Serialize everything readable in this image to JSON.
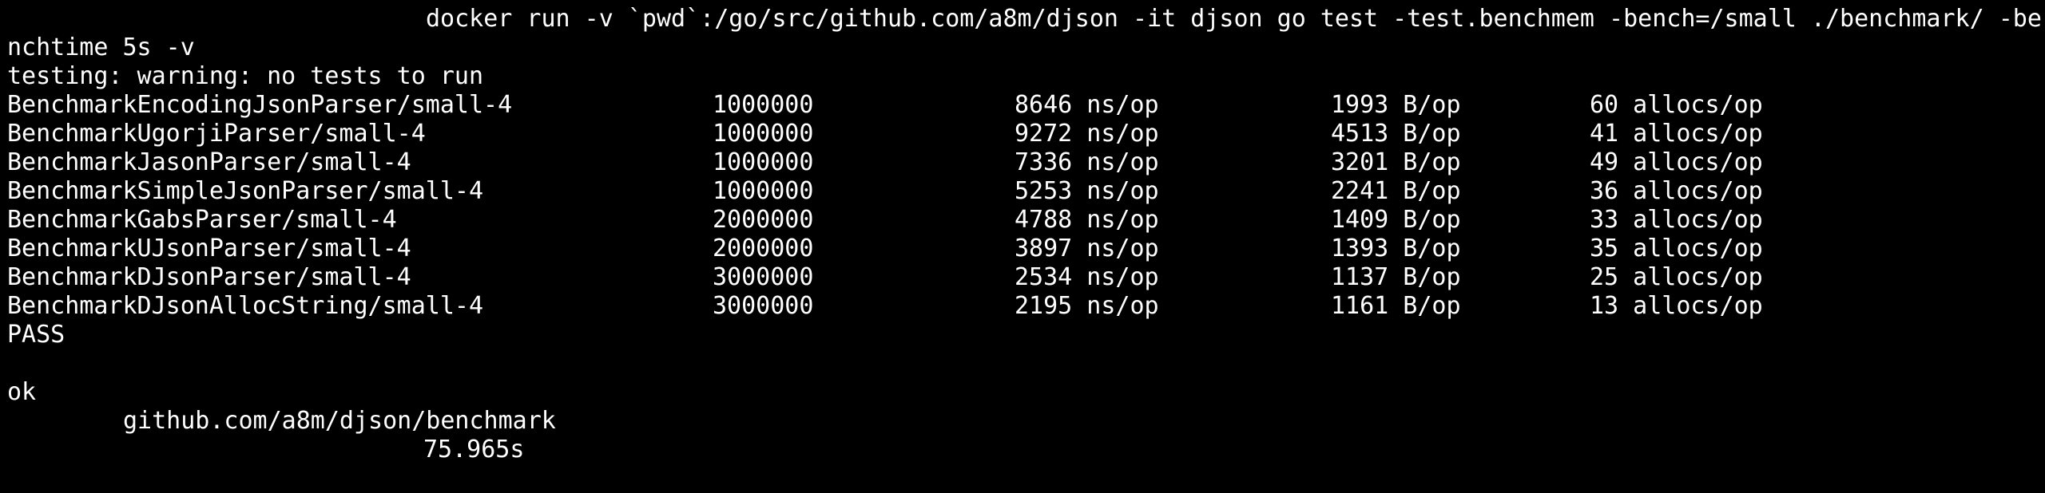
{
  "terminal": {
    "background": "#000000",
    "foreground": "#ffffff",
    "command_line": "docker run -v `pwd`:/go/src/github.com/a8m/djson -it djson go test -test.benchmem -bench=/small ./benchmark/ -be",
    "command_wrap": "nchtime 5s -v",
    "warning": "testing: warning: no tests to run",
    "benchmarks": [
      {
        "name": "BenchmarkEncodingJsonParser/small-4",
        "iterations": "1000000",
        "ns_per_op": "8646 ns/op",
        "bytes_per_op": "1993 B/op",
        "allocs_per_op": "60 allocs/op"
      },
      {
        "name": "BenchmarkUgorjiParser/small-4",
        "iterations": "1000000",
        "ns_per_op": "9272 ns/op",
        "bytes_per_op": "4513 B/op",
        "allocs_per_op": "41 allocs/op"
      },
      {
        "name": "BenchmarkJasonParser/small-4",
        "iterations": "1000000",
        "ns_per_op": "7336 ns/op",
        "bytes_per_op": "3201 B/op",
        "allocs_per_op": "49 allocs/op"
      },
      {
        "name": "BenchmarkSimpleJsonParser/small-4",
        "iterations": "1000000",
        "ns_per_op": "5253 ns/op",
        "bytes_per_op": "2241 B/op",
        "allocs_per_op": "36 allocs/op"
      },
      {
        "name": "BenchmarkGabsParser/small-4",
        "iterations": "2000000",
        "ns_per_op": "4788 ns/op",
        "bytes_per_op": "1409 B/op",
        "allocs_per_op": "33 allocs/op"
      },
      {
        "name": "BenchmarkUJsonParser/small-4",
        "iterations": "2000000",
        "ns_per_op": "3897 ns/op",
        "bytes_per_op": "1393 B/op",
        "allocs_per_op": "35 allocs/op"
      },
      {
        "name": "BenchmarkDJsonParser/small-4",
        "iterations": "3000000",
        "ns_per_op": "2534 ns/op",
        "bytes_per_op": "1137 B/op",
        "allocs_per_op": "25 allocs/op"
      },
      {
        "name": "BenchmarkDJsonAllocString/small-4",
        "iterations": "3000000",
        "ns_per_op": "2195 ns/op",
        "bytes_per_op": "1161 B/op",
        "allocs_per_op": "13 allocs/op"
      }
    ],
    "pass": "PASS",
    "result": {
      "status": "ok",
      "package": "github.com/a8m/djson/benchmark",
      "duration": "75.965s"
    }
  }
}
